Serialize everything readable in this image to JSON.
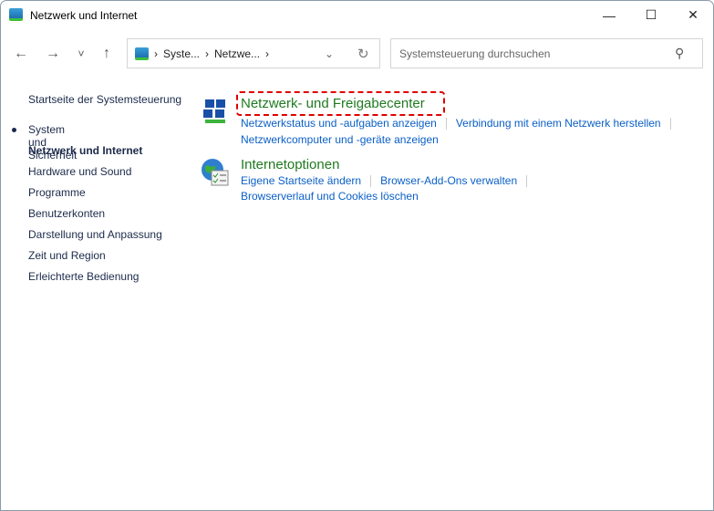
{
  "window": {
    "title": "Netzwerk und Internet",
    "minimize": "—",
    "maximize": "☐",
    "close": "✕"
  },
  "toolbar": {
    "back": "←",
    "forward": "→",
    "recent": "˅",
    "up": "↑",
    "breadcrumb": [
      "Syste...",
      "Netzwe..."
    ],
    "sep": "›",
    "dropdown": "⌄",
    "refresh": "↻",
    "search_placeholder": "Systemsteuerung durchsuchen",
    "search_icon": "⚲"
  },
  "sidebar": {
    "home": "Startseite der Systemsteuerung",
    "items": [
      "System und Sicherheit",
      "Netzwerk und Internet",
      "Hardware und Sound",
      "Programme",
      "Benutzerkonten",
      "Darstellung und Anpassung",
      "Zeit und Region",
      "Erleichterte Bedienung"
    ],
    "active_index": 1
  },
  "sections": [
    {
      "title": "Netzwerk- und Freigabecenter",
      "links": [
        "Netzwerkstatus und -aufgaben anzeigen",
        "Verbindung mit einem Netzwerk herstellen",
        "Netzwerkcomputer und -geräte anzeigen"
      ]
    },
    {
      "title": "Internetoptionen",
      "links": [
        "Eigene Startseite ändern",
        "Browser-Add-Ons verwalten",
        "Browserverlauf und Cookies löschen"
      ]
    }
  ],
  "colors": {
    "highlight": "#e00000",
    "heading": "#1f7a1f",
    "link": "#0a5fc7"
  }
}
